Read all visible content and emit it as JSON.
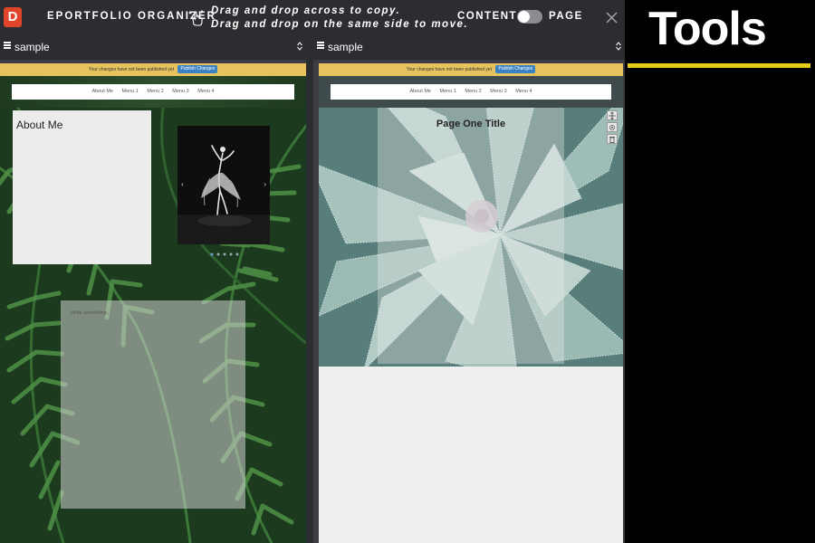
{
  "app": {
    "logo_letter": "D",
    "title": "EPORTFOLIO ORGANIZER",
    "instructions": [
      "Drag and drop across to copy.",
      "Drag and drop on the same side to move."
    ],
    "mode_left": "CONTENT",
    "mode_right": "PAGE",
    "toggle_on": false,
    "close_icon": "close-icon"
  },
  "left_pane": {
    "selector_value": "sample",
    "banner_text": "Your changes have not been published yet",
    "publish_label": "Publish Changes",
    "nav_items": [
      "About Me",
      "Menu 1",
      "Menu 2",
      "Menu 3",
      "Menu 4"
    ],
    "about_title": "About Me",
    "carousel_prev": "‹",
    "carousel_next": "›",
    "write_placeholder": "Write something..."
  },
  "right_pane": {
    "selector_value": "sample",
    "banner_text": "Your changes have not been published yet",
    "publish_label": "Publish Changes",
    "nav_items": [
      "About Me",
      "Menu 1",
      "Menu 2",
      "Menu 3",
      "Menu 4"
    ],
    "page_title": "Page One Title",
    "block_tools": [
      "move-icon",
      "gear-icon",
      "trash-icon"
    ]
  },
  "side_panel": {
    "heading": "Tools"
  },
  "colors": {
    "topbar": "#2b2d31",
    "pane_bg": "#3b3d42",
    "logo": "#e0452b",
    "banner": "#e6c35c",
    "publish_button": "#3b82c4",
    "tools_underline": "#e4cc1a"
  }
}
